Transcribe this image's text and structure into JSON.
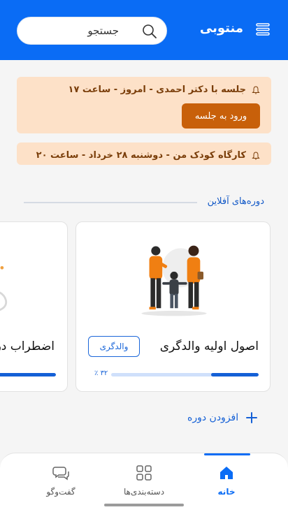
{
  "header": {
    "brand": "منتوبی",
    "search_placeholder": "جستجو"
  },
  "alerts": [
    {
      "text": "جلسه با دکتر احمدی - امروز - ساعت ۱۷",
      "button_label": "ورود به جلسه"
    },
    {
      "text": "کارگاه کودک من - دوشنبه ۲۸ خرداد - ساعت ۲۰"
    }
  ],
  "section": {
    "title": "دوره‌های آفلاین"
  },
  "courses": [
    {
      "title": "اصول اولیه والدگری",
      "tag": "والدگری",
      "progress_percent": 32,
      "progress_label": "۳۲ ٪"
    },
    {
      "title": "اضطراب در",
      "progress_percent": 100
    }
  ],
  "add_course_label": "افزودن دوره",
  "nav": {
    "home": "خانه",
    "categories": "دسته‌بندی‌ها",
    "chat": "گفت‌وگو"
  },
  "colors": {
    "primary": "#0a6cf5",
    "alert_bg": "#fde1c8",
    "alert_text": "#7a3e0a",
    "alert_button": "#c8600a"
  }
}
